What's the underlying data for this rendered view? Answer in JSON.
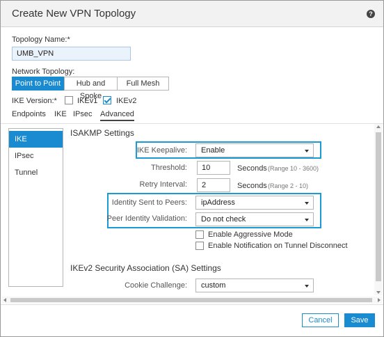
{
  "dialog": {
    "title": "Create New VPN Topology",
    "help_icon": "?"
  },
  "topology_name": {
    "label": "Topology Name:*",
    "value": "UMB_VPN"
  },
  "network_topology": {
    "label": "Network Topology:",
    "options": [
      "Point to Point",
      "Hub and Spoke",
      "Full Mesh"
    ],
    "selected": "Point to Point"
  },
  "ike_version": {
    "label": "IKE Version:*",
    "ikev1_label": "IKEv1",
    "ikev1_checked": false,
    "ikev2_label": "IKEv2",
    "ikev2_checked": true
  },
  "tabs": [
    "Endpoints",
    "IKE",
    "IPsec",
    "Advanced"
  ],
  "active_tab": "Advanced",
  "left_nav": [
    "IKE",
    "IPsec",
    "Tunnel"
  ],
  "active_nav": "IKE",
  "isakmp": {
    "title": "ISAKMP Settings",
    "keepalive_label": "IKE Keepalive:",
    "keepalive_value": "Enable",
    "threshold_label": "Threshold:",
    "threshold_value": "10",
    "threshold_unit": "Seconds",
    "threshold_range": "(Range 10 - 3600)",
    "retry_label": "Retry Interval:",
    "retry_value": "2",
    "retry_unit": "Seconds",
    "retry_range": "(Range 2 - 10)",
    "identity_label": "Identity Sent to Peers:",
    "identity_value": "ipAddress",
    "peer_validation_label": "Peer Identity Validation:",
    "peer_validation_value": "Do not check",
    "aggressive_label": "Enable Aggressive Mode",
    "aggressive_checked": false,
    "notification_label": "Enable Notification on Tunnel Disconnect",
    "notification_checked": false
  },
  "ikev2_sa": {
    "title": "IKEv2 Security Association (SA) Settings",
    "cookie_label": "Cookie Challenge:",
    "cookie_value": "custom"
  },
  "footer": {
    "cancel_label": "Cancel",
    "save_label": "Save"
  },
  "colors": {
    "accent": "#1a8bd1",
    "highlight": "#1c9ad6"
  }
}
